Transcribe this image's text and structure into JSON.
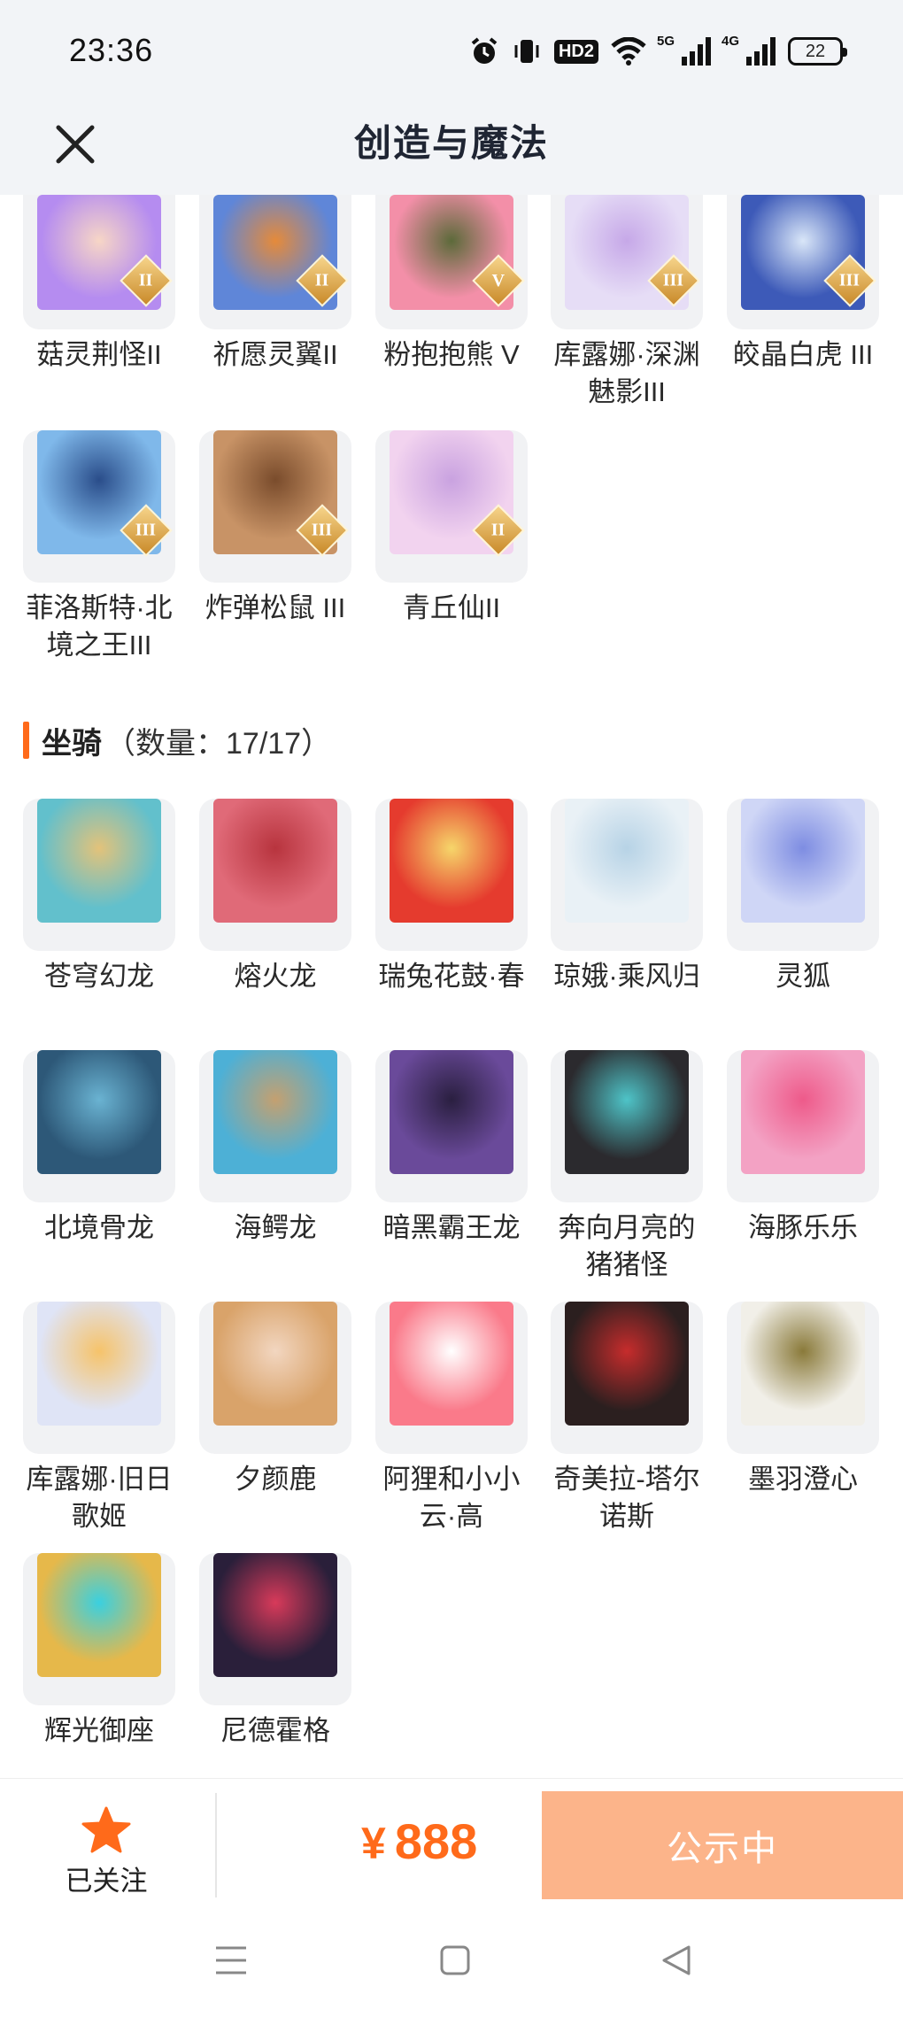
{
  "status_bar": {
    "time": "23:36",
    "hd_label": "HD2",
    "signal1_label": "5G",
    "signal2_label": "4G",
    "battery": "22"
  },
  "header": {
    "title": "创造与魔法",
    "close_icon": "close-icon"
  },
  "section_pets": {
    "items": [
      {
        "label": "菇灵荆怪II",
        "badge": "II",
        "icon": "purple-hair-character"
      },
      {
        "label": "祈愿灵翼II",
        "badge": "II",
        "icon": "blue-bird-creature"
      },
      {
        "label": "粉抱抱熊 V",
        "badge": "V",
        "icon": "pink-bear"
      },
      {
        "label": "库露娜·深渊魅影III",
        "badge": "III",
        "icon": "white-hair-girl"
      },
      {
        "label": "皎晶白虎 III",
        "badge": "III",
        "icon": "white-tiger"
      },
      {
        "label": "菲洛斯特·北境之王III",
        "badge": "III",
        "icon": "ice-king"
      },
      {
        "label": "炸弹松鼠 III",
        "badge": "III",
        "icon": "bomb-squirrel"
      },
      {
        "label": "青丘仙II",
        "badge": "II",
        "icon": "fox-fairy"
      }
    ]
  },
  "section_mounts": {
    "name": "坐骑",
    "count": "（数量：17/17）",
    "items": [
      {
        "label": "苍穹幻龙",
        "icon": "sky-dragon"
      },
      {
        "label": "熔火龙",
        "icon": "fire-dragon"
      },
      {
        "label": "瑞兔花鼓·春",
        "icon": "rabbit-drum"
      },
      {
        "label": "琼娥·乘风归",
        "icon": "moon-fairy"
      },
      {
        "label": "灵狐",
        "icon": "spirit-fox"
      },
      {
        "label": "北境骨龙",
        "icon": "bone-dragon"
      },
      {
        "label": "海鳄龙",
        "icon": "sea-dragon"
      },
      {
        "label": "暗黑霸王龙",
        "icon": "dark-trex"
      },
      {
        "label": "奔向月亮的猪猪怪",
        "icon": "moon-pig"
      },
      {
        "label": "海豚乐乐",
        "icon": "dolphin"
      },
      {
        "label": "库露娜·旧日歌姬",
        "icon": "singer-girl"
      },
      {
        "label": "夕颜鹿",
        "icon": "deer"
      },
      {
        "label": "阿狸和小小云·高",
        "icon": "ali-cloud"
      },
      {
        "label": "奇美拉-塔尔诺斯",
        "icon": "chimera"
      },
      {
        "label": "墨羽澄心",
        "icon": "feather-sword"
      },
      {
        "label": "辉光御座",
        "icon": "golden-throne"
      },
      {
        "label": "尼德霍格",
        "icon": "nidhogg-dragon"
      }
    ]
  },
  "bottom_bar": {
    "follow_label": "已关注",
    "price_symbol": "¥",
    "price": "888",
    "status_button": "公示中"
  },
  "colors": {
    "accent": "#ff6a1a",
    "status_button": "#fcb48a",
    "header_bg": "#f2f4f7",
    "thumb_bg": "#f1f2f4"
  }
}
